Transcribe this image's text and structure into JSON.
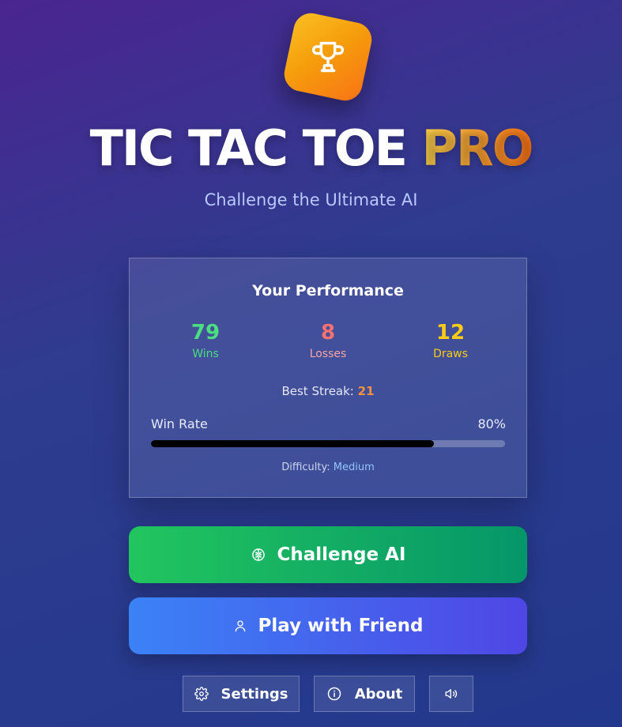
{
  "logo": {
    "icon": "trophy-icon"
  },
  "title": {
    "main": "TIC TAC TOE",
    "accent": "PRO"
  },
  "subtitle": "Challenge the Ultimate AI",
  "performance": {
    "heading": "Your Performance",
    "wins": {
      "value": "79",
      "label": "Wins"
    },
    "losses": {
      "value": "8",
      "label": "Losses"
    },
    "draws": {
      "value": "12",
      "label": "Draws"
    },
    "best_streak_label": "Best Streak:",
    "best_streak_value": "21",
    "win_rate_label": "Win Rate",
    "win_rate_text": "80%",
    "win_rate_fraction": 0.8,
    "difficulty_label": "Difficulty:",
    "difficulty_value": "Medium"
  },
  "actions": {
    "challenge_ai": {
      "label": "Challenge AI",
      "icon": "brain-icon"
    },
    "play_friend": {
      "label": "Play with Friend",
      "icon": "user-icon"
    }
  },
  "footer": {
    "settings": {
      "label": "Settings",
      "icon": "gear-icon"
    },
    "about": {
      "label": "About",
      "icon": "info-icon"
    },
    "sound": {
      "icon": "speaker-icon"
    }
  },
  "colors": {
    "wins": "#4ade80",
    "losses": "#f87171",
    "draws": "#facc15",
    "streak": "#fb923c",
    "difficulty": "#93c5fd",
    "accent_start": "#fcd34d",
    "accent_end": "#f97316"
  }
}
